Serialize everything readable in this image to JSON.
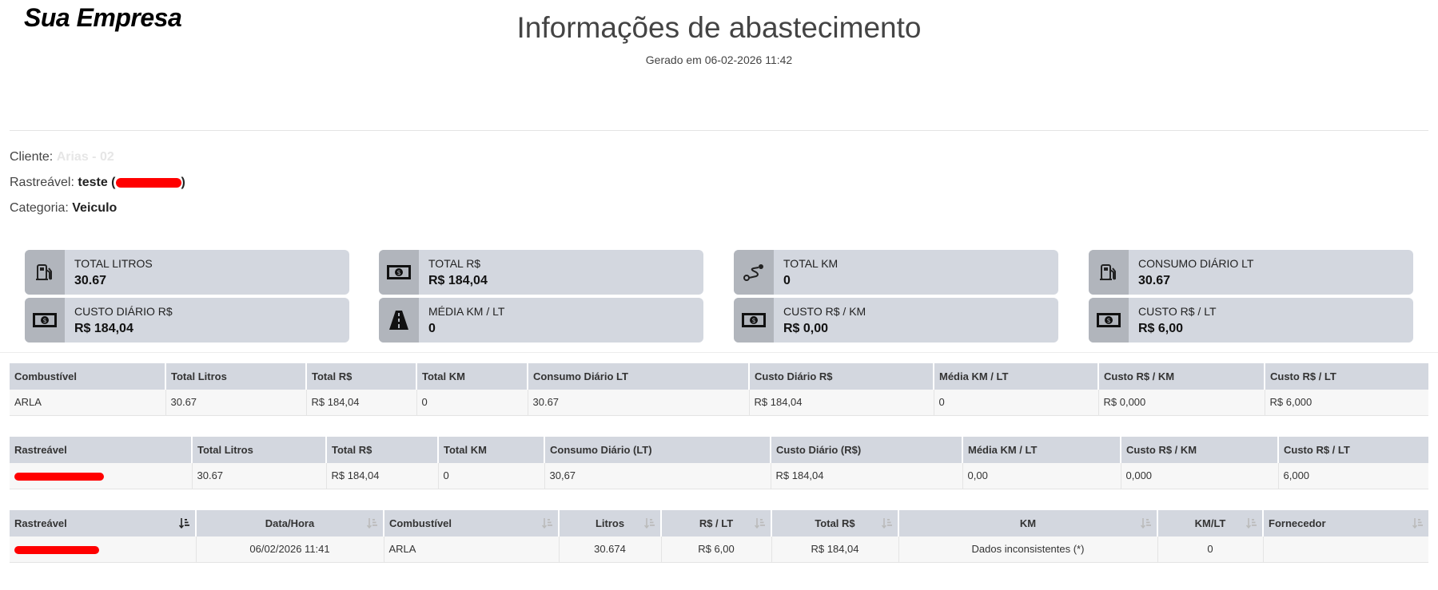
{
  "header": {
    "logo": "Sua Empresa",
    "title": "Informações de abastecimento",
    "generated": "Gerado em 06-02-2026 11:42"
  },
  "info": {
    "cliente_label": "Cliente: ",
    "cliente_value": "Arias - 02",
    "rastreavel_label": "Rastreável: ",
    "rastreavel_value": "teste (",
    "rastreavel_close": ")",
    "categoria_label": "Categoria: ",
    "categoria_value": "Veiculo"
  },
  "cards": [
    {
      "label": "TOTAL LITROS",
      "value": "30.67",
      "icon": "fuel-pump-icon"
    },
    {
      "label": "TOTAL R$",
      "value": "R$ 184,04",
      "icon": "money-bill-icon"
    },
    {
      "label": "TOTAL KM",
      "value": "0",
      "icon": "route-icon"
    },
    {
      "label": "CONSUMO DIÁRIO LT",
      "value": "30.67",
      "icon": "fuel-pump-icon"
    },
    {
      "label": "CUSTO DIÁRIO R$",
      "value": "R$ 184,04",
      "icon": "money-bill-icon"
    },
    {
      "label": "MÉDIA KM / LT",
      "value": "0",
      "icon": "road-icon"
    },
    {
      "label": "CUSTO R$ / KM",
      "value": "R$ 0,00",
      "icon": "money-bill-icon"
    },
    {
      "label": "CUSTO R$ / LT",
      "value": "R$ 6,00",
      "icon": "money-bill-icon"
    }
  ],
  "table_fuel": {
    "headers": [
      "Combustível",
      "Total Litros",
      "Total R$",
      "Total KM",
      "Consumo Diário LT",
      "Custo Diário R$",
      "Média KM / LT",
      "Custo R$ / KM",
      "Custo R$ / LT"
    ],
    "row": [
      "ARLA",
      "30.67",
      "R$ 184,04",
      "0",
      "30.67",
      "R$ 184,04",
      "0",
      "R$ 0,000",
      "R$ 6,000"
    ]
  },
  "table_tracker": {
    "headers": [
      "Rastreável",
      "Total Litros",
      "Total R$",
      "Total KM",
      "Consumo Diário (LT)",
      "Custo Diário (R$)",
      "Média KM / LT",
      "Custo R$ / KM",
      "Custo R$ / LT"
    ],
    "row": [
      "",
      "30.67",
      "R$ 184,04",
      "0",
      "30,67",
      "R$ 184,04",
      "0,00",
      "0,000",
      "6,000"
    ]
  },
  "table_records": {
    "headers": [
      "Rastreável",
      "Data/Hora",
      "Combustível",
      "Litros",
      "R$ / LT",
      "Total R$",
      "KM",
      "KM/LT",
      "Fornecedor"
    ],
    "row": [
      "",
      "06/02/2026 11:41",
      "ARLA",
      "30.674",
      "R$ 6,00",
      "R$ 184,04",
      "Dados inconsistentes (*)",
      "0",
      ""
    ]
  }
}
